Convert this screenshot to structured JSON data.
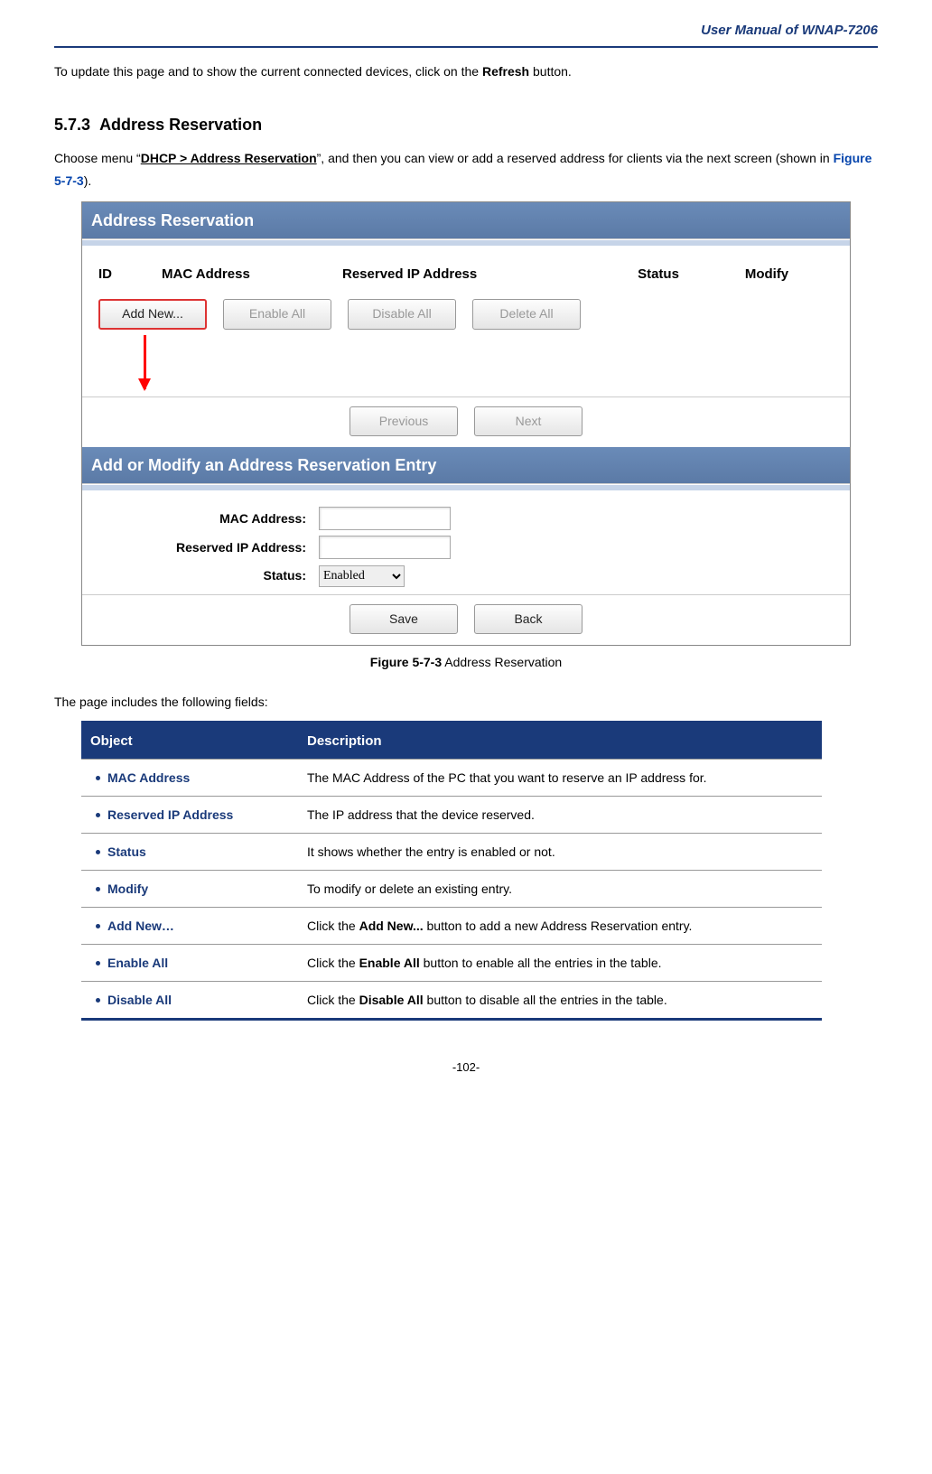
{
  "header": {
    "title": "User Manual of WNAP-7206"
  },
  "intro": {
    "pre": "To update this page and to show the current connected devices, click on the ",
    "bold": "Refresh",
    "post": " button."
  },
  "section": {
    "number": "5.7.3",
    "title": "Address Reservation"
  },
  "menu": {
    "pre": "Choose menu “",
    "path": "DHCP > Address Reservation",
    "mid": "”, and then you can view or add a reserved address for clients via the next screen (shown in ",
    "figref": "Figure 5-7-3",
    "post": ")."
  },
  "figure": {
    "panel1_title": "Address Reservation",
    "cols": {
      "id": "ID",
      "mac": "MAC Address",
      "ip": "Reserved IP Address",
      "status": "Status",
      "modify": "Modify"
    },
    "buttons": {
      "add_new": "Add New...",
      "enable_all": "Enable All",
      "disable_all": "Disable All",
      "delete_all": "Delete All",
      "previous": "Previous",
      "next": "Next",
      "save": "Save",
      "back": "Back"
    },
    "panel2_title": "Add or Modify an Address Reservation Entry",
    "form": {
      "mac_label": "MAC Address:",
      "ip_label": "Reserved IP Address:",
      "status_label": "Status:",
      "status_value": "Enabled"
    },
    "caption_bold": "Figure 5-7-3",
    "caption_rest": " Address Reservation"
  },
  "fields_intro": "The page includes the following fields:",
  "table": {
    "head": {
      "object": "Object",
      "description": "Description"
    },
    "rows": [
      {
        "object": "MAC Address",
        "desc_pre": "The MAC Address of the PC that you want to reserve an IP address for.",
        "bold": "",
        "desc_post": ""
      },
      {
        "object": "Reserved IP Address",
        "desc_pre": "The IP address that the device reserved.",
        "bold": "",
        "desc_post": ""
      },
      {
        "object": "Status",
        "desc_pre": "It shows whether the entry is enabled or not.",
        "bold": "",
        "desc_post": ""
      },
      {
        "object": "Modify",
        "desc_pre": "To modify or delete an existing entry.",
        "bold": "",
        "desc_post": ""
      },
      {
        "object": "Add New…",
        "desc_pre": "Click the ",
        "bold": "Add New...",
        "desc_post": " button to add a new Address Reservation entry."
      },
      {
        "object": "Enable All",
        "desc_pre": "Click the ",
        "bold": "Enable All",
        "desc_post": " button to enable all the entries in the table."
      },
      {
        "object": "Disable All",
        "desc_pre": "Click the ",
        "bold": "Disable All",
        "desc_post": " button to disable all the entries in the table."
      }
    ]
  },
  "footer": {
    "page": "-102-"
  }
}
